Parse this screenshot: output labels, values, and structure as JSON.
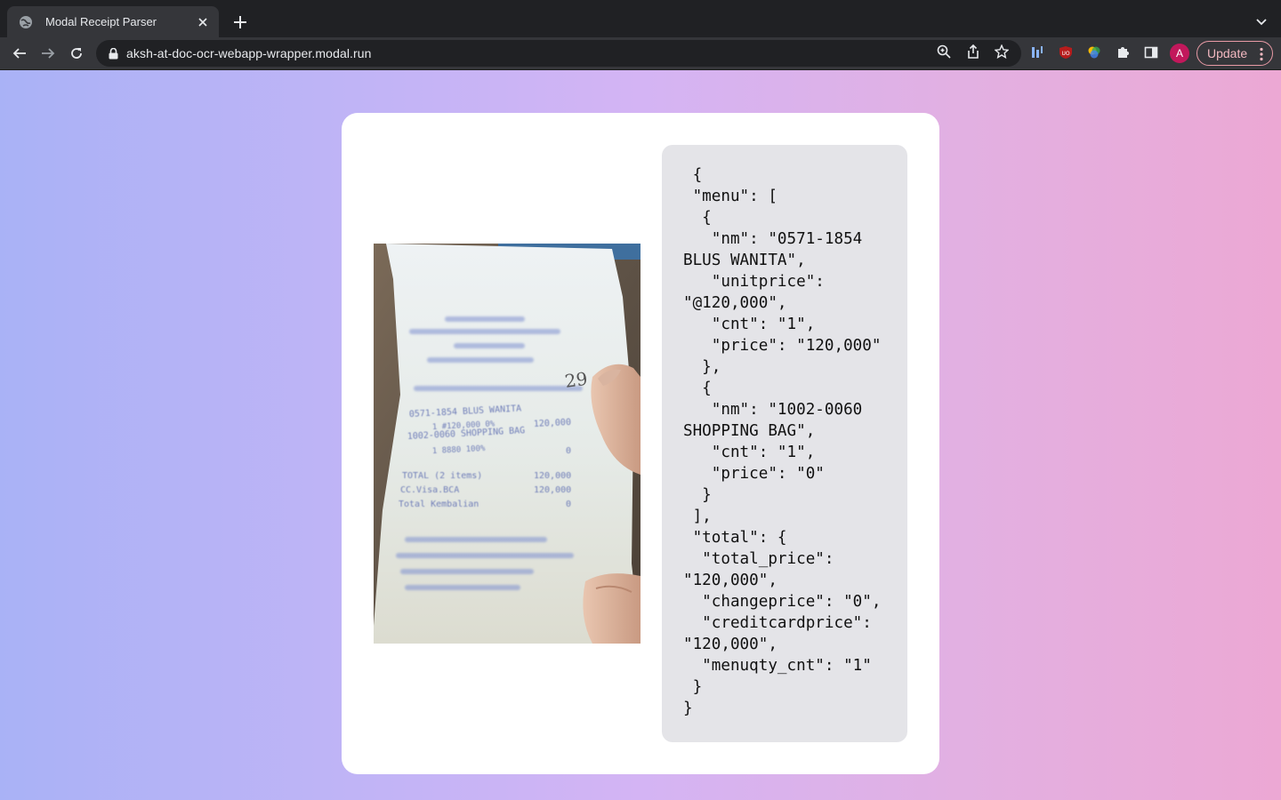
{
  "browser": {
    "tab_title": "Modal Receipt Parser",
    "url": "aksh-at-doc-ocr-webapp-wrapper.modal.run",
    "profile_initial": "A",
    "update_label": "Update"
  },
  "receipt_image": {
    "handwritten": "29",
    "lines": [
      {
        "left": "0571-1854 BLUS WANITA",
        "right": ""
      },
      {
        "left": "1  #120,000  0%",
        "right": "120,000"
      },
      {
        "left": "1002-0060 SHOPPING BAG",
        "right": ""
      },
      {
        "left": "1  8880 100%",
        "right": "0"
      },
      {
        "left": "TOTAL (2 items)",
        "right": "120,000"
      },
      {
        "left": "CC.Visa.BCA",
        "right": "120,000"
      },
      {
        "left": "Total Kembalian",
        "right": "0"
      }
    ]
  },
  "json_output": [
    " {",
    " \"menu\": [",
    "  {",
    "   \"nm\": \"0571-1854",
    "BLUS WANITA\",",
    "   \"unitprice\":",
    "\"@120,000\",",
    "   \"cnt\": \"1\",",
    "   \"price\": \"120,000\"",
    "  },",
    "  {",
    "   \"nm\": \"1002-0060",
    "SHOPPING BAG\",",
    "   \"cnt\": \"1\",",
    "   \"price\": \"0\"",
    "  }",
    " ],",
    " \"total\": {",
    "  \"total_price\":",
    "\"120,000\",",
    "  \"changeprice\": \"0\",",
    "  \"creditcardprice\":",
    "\"120,000\",",
    "  \"menuqty_cnt\": \"1\"",
    " }",
    "}"
  ]
}
